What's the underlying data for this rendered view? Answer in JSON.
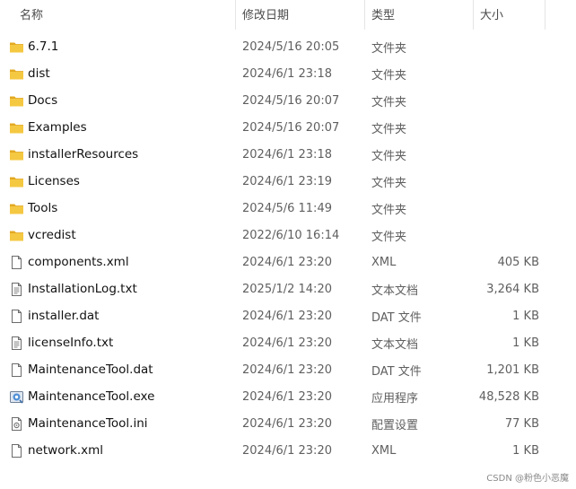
{
  "columns": {
    "name": "名称",
    "date": "修改日期",
    "type": "类型",
    "size": "大小",
    "sort_indicator": "^"
  },
  "files": [
    {
      "name": "6.7.1",
      "date": "2024/5/16 20:05",
      "type": "文件夹",
      "size": "",
      "icon": "folder-icon"
    },
    {
      "name": "dist",
      "date": "2024/6/1 23:18",
      "type": "文件夹",
      "size": "",
      "icon": "folder-icon"
    },
    {
      "name": "Docs",
      "date": "2024/5/16 20:07",
      "type": "文件夹",
      "size": "",
      "icon": "folder-icon"
    },
    {
      "name": "Examples",
      "date": "2024/5/16 20:07",
      "type": "文件夹",
      "size": "",
      "icon": "folder-icon"
    },
    {
      "name": "installerResources",
      "date": "2024/6/1 23:18",
      "type": "文件夹",
      "size": "",
      "icon": "folder-icon"
    },
    {
      "name": "Licenses",
      "date": "2024/6/1 23:19",
      "type": "文件夹",
      "size": "",
      "icon": "folder-icon"
    },
    {
      "name": "Tools",
      "date": "2024/5/6 11:49",
      "type": "文件夹",
      "size": "",
      "icon": "folder-icon"
    },
    {
      "name": "vcredist",
      "date": "2022/6/10 16:14",
      "type": "文件夹",
      "size": "",
      "icon": "folder-icon"
    },
    {
      "name": "components.xml",
      "date": "2024/6/1 23:20",
      "type": "XML",
      "size": "405 KB",
      "icon": "file-icon"
    },
    {
      "name": "InstallationLog.txt",
      "date": "2025/1/2 14:20",
      "type": "文本文档",
      "size": "3,264 KB",
      "icon": "text-file-icon"
    },
    {
      "name": "installer.dat",
      "date": "2024/6/1 23:20",
      "type": "DAT 文件",
      "size": "1 KB",
      "icon": "file-icon"
    },
    {
      "name": "licenseInfo.txt",
      "date": "2024/6/1 23:20",
      "type": "文本文档",
      "size": "1 KB",
      "icon": "text-file-icon"
    },
    {
      "name": "MaintenanceTool.dat",
      "date": "2024/6/1 23:20",
      "type": "DAT 文件",
      "size": "1,201 KB",
      "icon": "file-icon"
    },
    {
      "name": "MaintenanceTool.exe",
      "date": "2024/6/1 23:20",
      "type": "应用程序",
      "size": "48,528 KB",
      "icon": "app-icon"
    },
    {
      "name": "MaintenanceTool.ini",
      "date": "2024/6/1 23:20",
      "type": "配置设置",
      "size": "77 KB",
      "icon": "settings-file-icon"
    },
    {
      "name": "network.xml",
      "date": "2024/6/1 23:20",
      "type": "XML",
      "size": "1 KB",
      "icon": "file-icon"
    }
  ],
  "watermark": "CSDN @粉色小恶魔",
  "colors": {
    "folder": "#F5C842",
    "folder_dark": "#E3A922",
    "header_text": "#4a4a4a",
    "meta_text": "#5f5f5f"
  }
}
